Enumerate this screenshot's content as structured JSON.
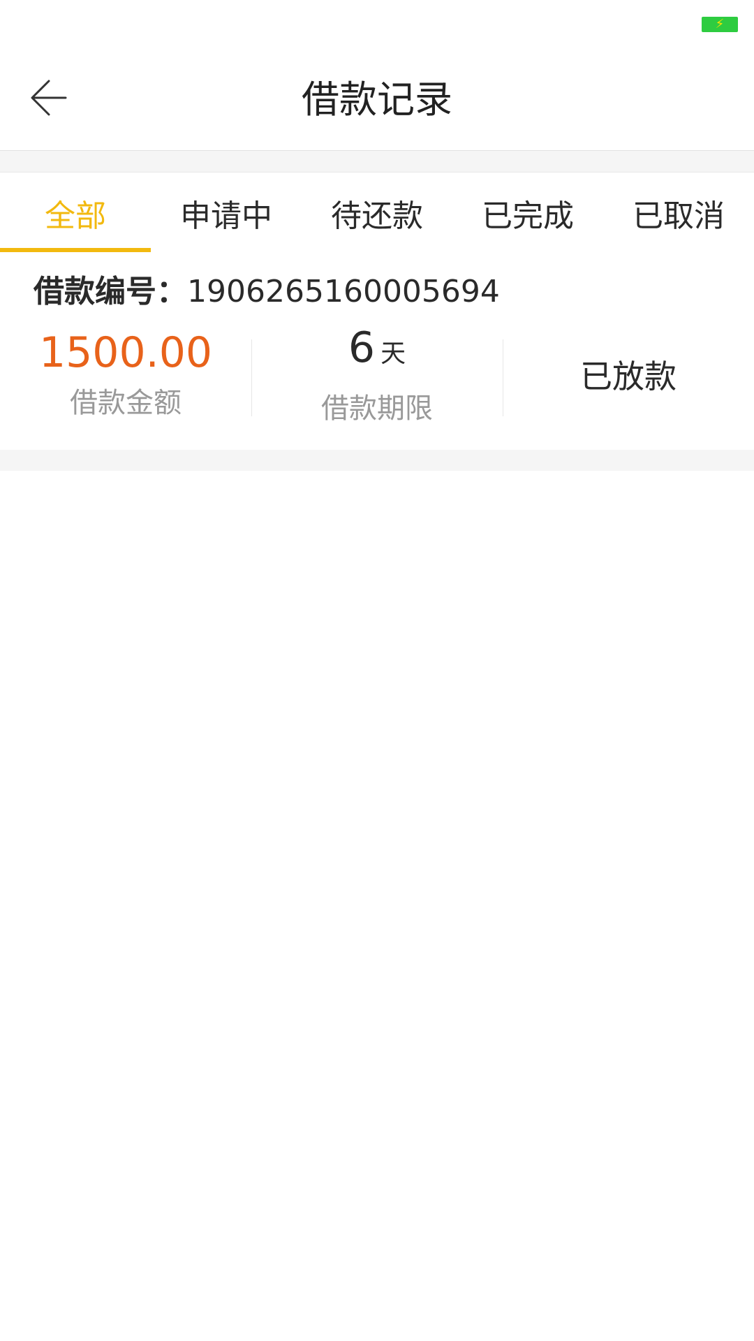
{
  "status_bar": {
    "battery_icon": "battery-charging-icon",
    "battery_color": "#2ecc40"
  },
  "nav": {
    "title": "借款记录",
    "back_icon": "arrow-left-icon"
  },
  "tabs": [
    {
      "label": "全部",
      "active": true
    },
    {
      "label": "申请中",
      "active": false
    },
    {
      "label": "待还款",
      "active": false
    },
    {
      "label": "已完成",
      "active": false
    },
    {
      "label": "已取消",
      "active": false
    }
  ],
  "record": {
    "number_label": "借款编号：",
    "number_value": "1906265160005694",
    "amount": "1500.00",
    "amount_label": "借款金额",
    "term_value": "6",
    "term_unit": "天",
    "term_label": "借款期限",
    "status": "已放款"
  },
  "colors": {
    "accent": "#f2b90f",
    "amount": "#e8621a",
    "muted": "#999999"
  }
}
